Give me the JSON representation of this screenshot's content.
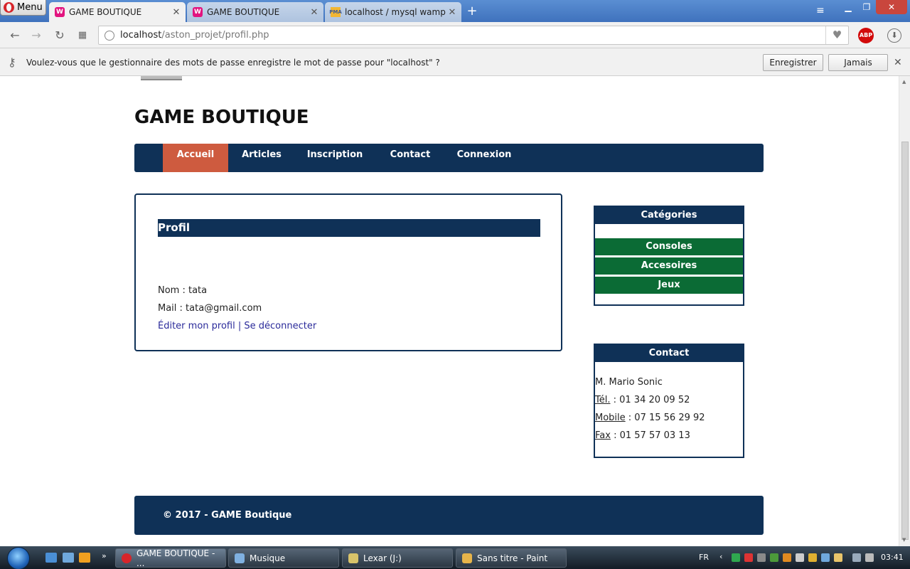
{
  "browser": {
    "menu_label": "Menu",
    "tabs": [
      {
        "title": "GAME BOUTIQUE"
      },
      {
        "title": "GAME BOUTIQUE"
      },
      {
        "title": "localhost / mysql wampse"
      }
    ],
    "url_host": "localhost",
    "url_path": "/aston_projet/profil.php",
    "password_prompt": {
      "message": "Voulez-vous que le gestionnaire des mots de passe enregistre le mot de passe pour \"localhost\" ?",
      "save_label": "Enregistrer",
      "never_label": "Jamais"
    }
  },
  "site": {
    "title": "GAME BOUTIQUE",
    "nav": [
      {
        "label": "Accueil",
        "active": true
      },
      {
        "label": "Articles",
        "active": false
      },
      {
        "label": "Inscription",
        "active": false
      },
      {
        "label": "Contact",
        "active": false
      },
      {
        "label": "Connexion",
        "active": false
      }
    ],
    "profile": {
      "heading": "Profil",
      "name_line": "Nom : tata",
      "mail_line": "Mail : tata@gmail.com",
      "edit_link": "Éditer mon profil",
      "separator": " | ",
      "logout_link": "Se déconnecter"
    },
    "categories": {
      "heading": "Catégories",
      "items": [
        "Consoles",
        "Accesoires",
        "Jeux"
      ]
    },
    "contact": {
      "heading": "Contact",
      "name": "M. Mario Sonic",
      "tel_label": "Tél.",
      "tel_value": " : 01 34 20 09 52",
      "mobile_label": "Mobile",
      "mobile_value": " : 07 15 56 29 92",
      "fax_label": "Fax",
      "fax_value": " : 01 57 57 03 13"
    },
    "footer": "© 2017 - GAME Boutique"
  },
  "taskbar": {
    "windows": [
      {
        "label": "GAME BOUTIQUE - ..."
      },
      {
        "label": "Musique"
      },
      {
        "label": "Lexar (J:)"
      },
      {
        "label": "Sans titre - Paint"
      }
    ],
    "language": "FR",
    "clock": "03:41"
  },
  "colors": {
    "site_navy": "#0f3157",
    "nav_active": "#ce5b3f",
    "category_green": "#0b6b35"
  }
}
